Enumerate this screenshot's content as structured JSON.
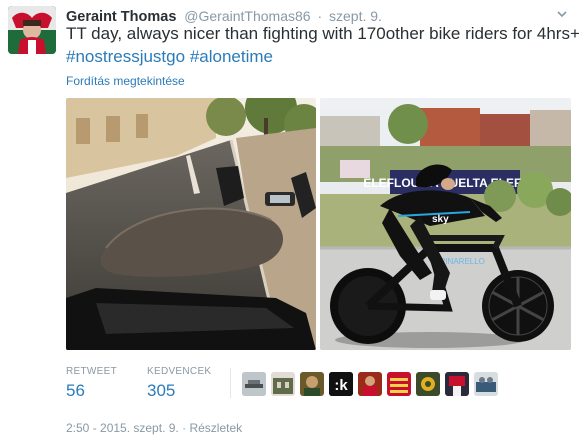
{
  "tweet": {
    "fullname": "Geraint Thomas",
    "username": "@GeraintThomas86",
    "separator": "·",
    "date": "szept. 9.",
    "text_plain": "TT day, always nicer than fighting with 170other bike riders for 4hrs+...",
    "hashtag_1": "#nostressjustgo",
    "hashtag_2": "#alonetime",
    "translate_link": "Fordítás megtekintése"
  },
  "photos": {
    "left_banner_text": "",
    "right_banner_text": "ELEFLOU  LA VUELTA  ELEFLOU",
    "jersey_text": "sky"
  },
  "stats": {
    "retweet_label": "RETWEET",
    "retweet_count": "56",
    "fav_label": "KEDVENCEK",
    "fav_count": "305"
  },
  "favoriters": {
    "k_glyph": ":k"
  },
  "footer": {
    "timestamp": "2:50 - 2015. szept. 9.",
    "separator": "·",
    "details_link": "Részletek"
  },
  "colors": {
    "link": "#2b7bb9",
    "muted": "#8899a6",
    "text": "#292f33"
  }
}
